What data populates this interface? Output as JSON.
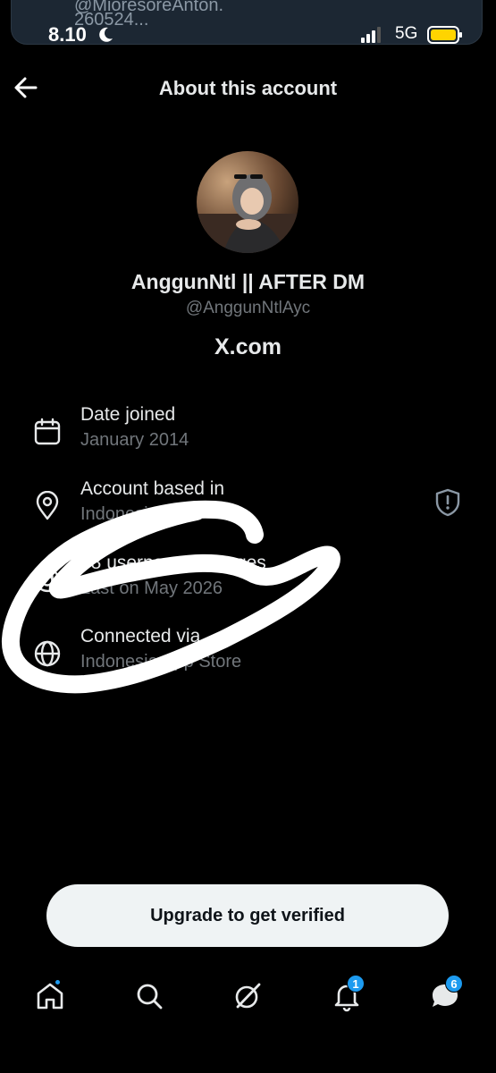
{
  "notification": {
    "line1": "@MioresoreAnton.",
    "line2": "260524..."
  },
  "status_bar": {
    "time": "8.10",
    "network": "5G",
    "battery_color": "#ffd400"
  },
  "header": {
    "title": "About this account"
  },
  "profile": {
    "display_name": "AnggunNtl || AFTER DM",
    "handle": "@AnggunNtlAyc",
    "domain": "X.com"
  },
  "info_rows": [
    {
      "icon": "calendar-icon",
      "title": "Date joined",
      "subtitle": "January 2014"
    },
    {
      "icon": "location-pin-icon",
      "title": "Account based in",
      "subtitle": "Indonesia",
      "trailing_icon": "shield-icon"
    },
    {
      "icon": "at-sign-icon",
      "title": "88 username changes",
      "subtitle": "Last on May 2026"
    },
    {
      "icon": "globe-icon",
      "title": "Connected via",
      "subtitle": "Indonesia App Store"
    }
  ],
  "upgrade_button": {
    "label": "Upgrade to get verified"
  },
  "bottom_nav": {
    "items": [
      {
        "icon": "home-icon"
      },
      {
        "icon": "search-icon"
      },
      {
        "icon": "grok-icon"
      },
      {
        "icon": "bell-icon",
        "badge": "1"
      },
      {
        "icon": "chat-icon",
        "badge": "6"
      }
    ]
  },
  "colors": {
    "background": "#000000",
    "text_primary": "#e7e9ea",
    "text_secondary": "#71767b",
    "accent": "#1d9bf0"
  }
}
